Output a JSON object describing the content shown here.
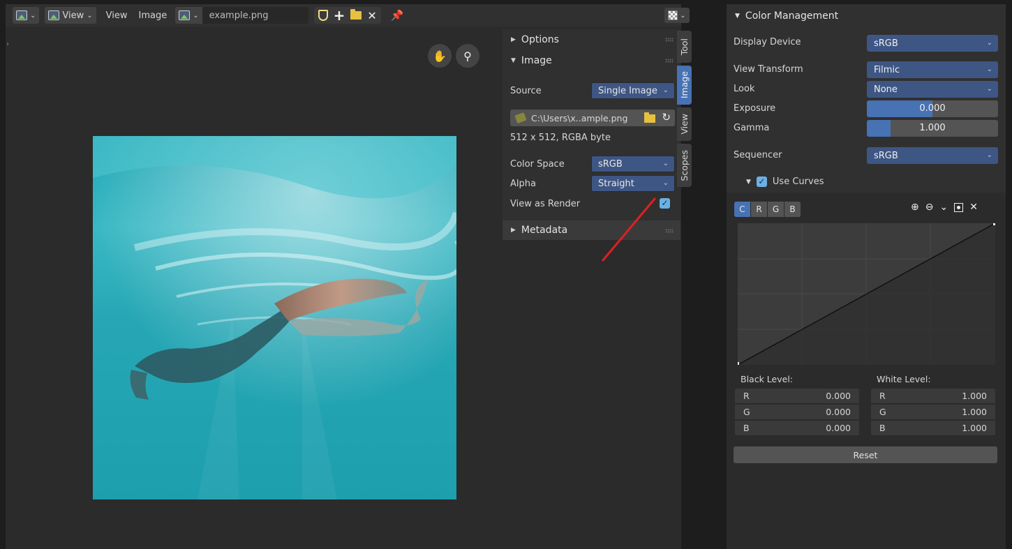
{
  "header": {
    "view_menu_label": "View",
    "menu_view": "View",
    "menu_image": "Image",
    "image_name": "example.png"
  },
  "image_panel": {
    "options_label": "Options",
    "image_label": "Image",
    "source_label": "Source",
    "source_value": "Single Image",
    "filepath": "C:\\Users\\x..ample.png",
    "info": "512 x 512,  RGBA byte",
    "color_space_label": "Color Space",
    "color_space_value": "sRGB",
    "alpha_label": "Alpha",
    "alpha_value": "Straight",
    "view_as_render_label": "View as Render",
    "view_as_render_checked": true,
    "metadata_label": "Metadata"
  },
  "tabs": [
    "Tool",
    "Image",
    "View",
    "Scopes"
  ],
  "active_tab": "Image",
  "color_management": {
    "title": "Color Management",
    "display_device_label": "Display Device",
    "display_device_value": "sRGB",
    "view_transform_label": "View Transform",
    "view_transform_value": "Filmic",
    "look_label": "Look",
    "look_value": "None",
    "exposure_label": "Exposure",
    "exposure_value": "0.000",
    "gamma_label": "Gamma",
    "gamma_value": "1.000",
    "sequencer_label": "Sequencer",
    "sequencer_value": "sRGB",
    "use_curves_label": "Use Curves",
    "channels": [
      "C",
      "R",
      "G",
      "B"
    ],
    "black_level_label": "Black Level:",
    "white_level_label": "White Level:",
    "black_level": [
      {
        "channel": "R",
        "value": "0.000"
      },
      {
        "channel": "G",
        "value": "0.000"
      },
      {
        "channel": "B",
        "value": "0.000"
      }
    ],
    "white_level": [
      {
        "channel": "R",
        "value": "1.000"
      },
      {
        "channel": "G",
        "value": "1.000"
      },
      {
        "channel": "B",
        "value": "1.000"
      }
    ],
    "reset_label": "Reset"
  },
  "colors": {
    "accent": "#4772b3",
    "select_blue": "#3e5684",
    "checkbox": "#6cb0e4",
    "annotation_arrow": "#e02020"
  }
}
